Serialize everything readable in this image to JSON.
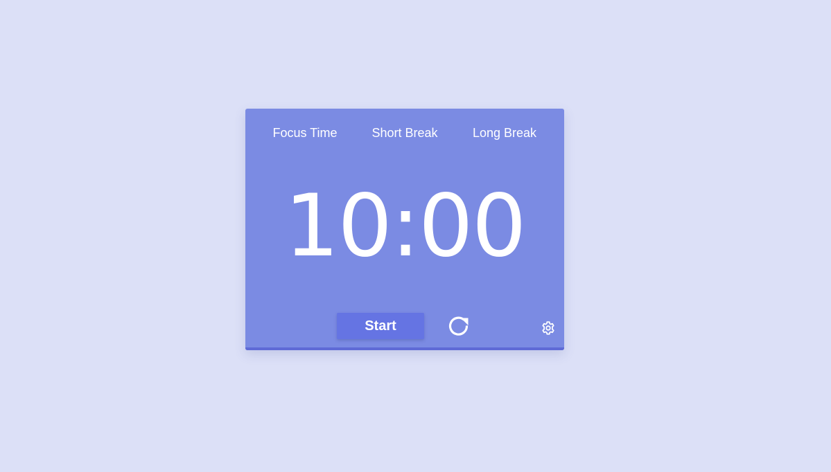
{
  "tabs": [
    {
      "label": "Focus Time"
    },
    {
      "label": "Short Break"
    },
    {
      "label": "Long Break"
    }
  ],
  "timer": {
    "display": "10:00"
  },
  "controls": {
    "start_label": "Start",
    "reset_icon": "reset-icon",
    "settings_icon": "gear-icon"
  },
  "colors": {
    "page_background": "#dce0f7",
    "card": "#7b8be3",
    "button": "#6574e3",
    "text": "#ffffff",
    "progress": "#5e6ad6"
  }
}
